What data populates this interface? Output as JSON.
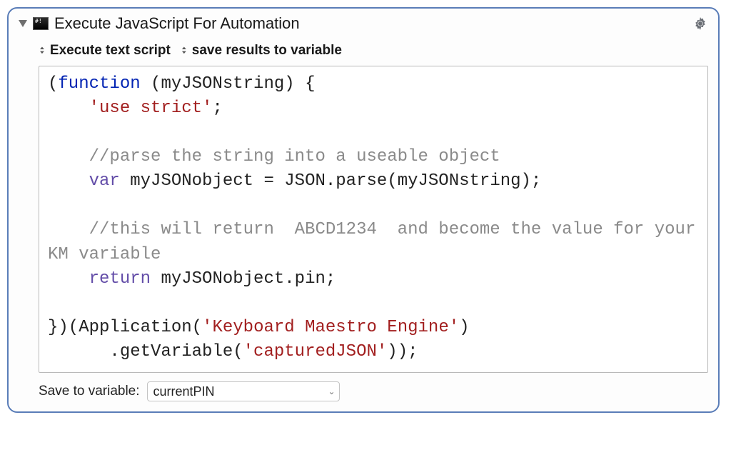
{
  "action": {
    "title": "Execute JavaScript For Automation"
  },
  "options": {
    "mode_label": "Execute text script",
    "output_label": "save results to variable"
  },
  "code": {
    "tokens": [
      {
        "t": "punc",
        "s": "("
      },
      {
        "t": "kw",
        "s": "function"
      },
      {
        "t": "punc",
        "s": " ("
      },
      {
        "t": "id",
        "s": "myJSONstring"
      },
      {
        "t": "punc",
        "s": ") {"
      },
      {
        "t": "nl"
      },
      {
        "t": "punc",
        "s": "    "
      },
      {
        "t": "str",
        "s": "'use strict'"
      },
      {
        "t": "punc",
        "s": ";"
      },
      {
        "t": "nl"
      },
      {
        "t": "nl"
      },
      {
        "t": "punc",
        "s": "    "
      },
      {
        "t": "com",
        "s": "//parse the string into a useable object"
      },
      {
        "t": "nl"
      },
      {
        "t": "punc",
        "s": "    "
      },
      {
        "t": "purple",
        "s": "var"
      },
      {
        "t": "punc",
        "s": " "
      },
      {
        "t": "id",
        "s": "myJSONobject = JSON.parse(myJSONstring);"
      },
      {
        "t": "nl"
      },
      {
        "t": "nl"
      },
      {
        "t": "punc",
        "s": "    "
      },
      {
        "t": "com",
        "s": "//this will return  ABCD1234  and become the value for your KM variable"
      },
      {
        "t": "nl"
      },
      {
        "t": "punc",
        "s": "    "
      },
      {
        "t": "purple",
        "s": "return"
      },
      {
        "t": "punc",
        "s": " "
      },
      {
        "t": "id",
        "s": "myJSONobject.pin;"
      },
      {
        "t": "nl"
      },
      {
        "t": "nl"
      },
      {
        "t": "punc",
        "s": "})("
      },
      {
        "t": "id",
        "s": "Application"
      },
      {
        "t": "punc",
        "s": "("
      },
      {
        "t": "str",
        "s": "'Keyboard Maestro Engine'"
      },
      {
        "t": "punc",
        "s": ")"
      },
      {
        "t": "nl"
      },
      {
        "t": "punc",
        "s": "      .getVariable("
      },
      {
        "t": "str",
        "s": "'capturedJSON'"
      },
      {
        "t": "punc",
        "s": "));"
      }
    ]
  },
  "footer": {
    "label": "Save to variable:",
    "variable_name": "currentPIN"
  }
}
